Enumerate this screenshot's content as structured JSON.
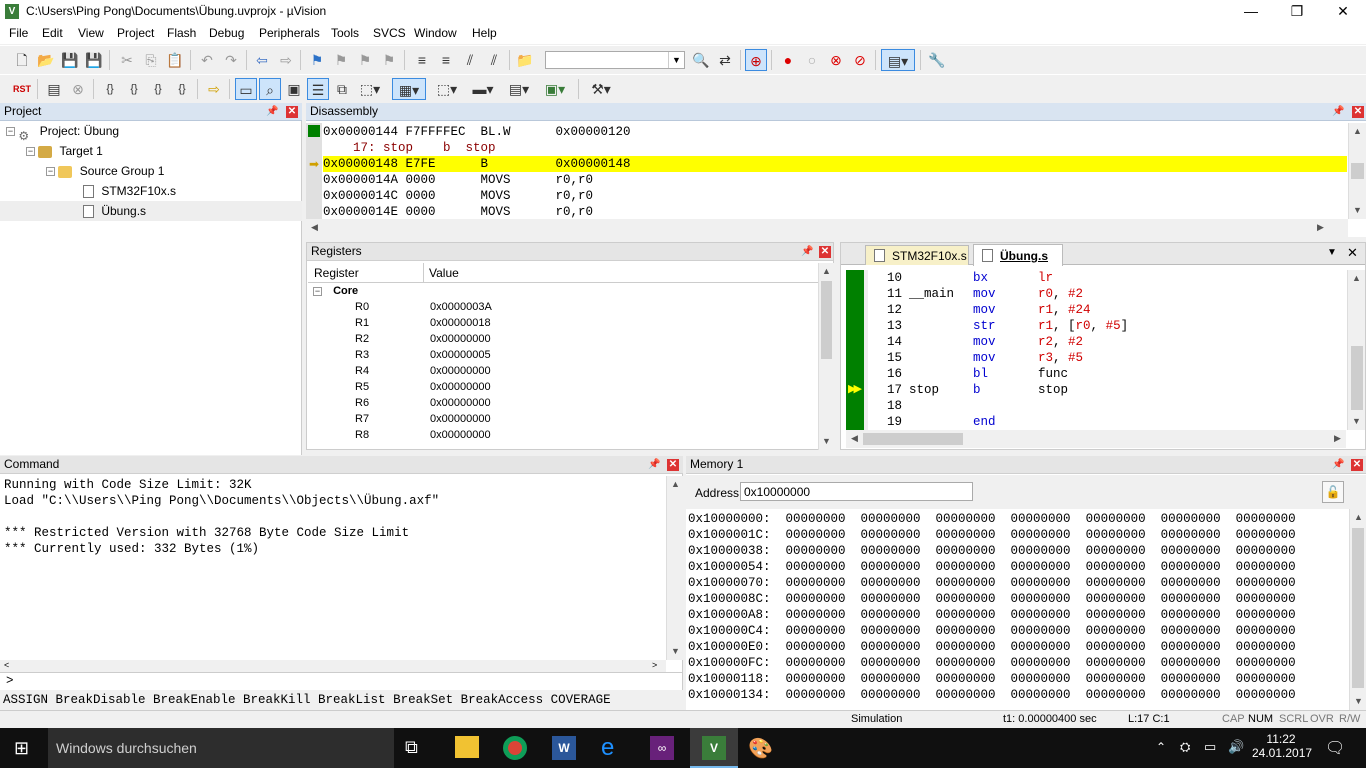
{
  "window": {
    "title": "C:\\Users\\Ping Pong\\Documents\\Übung.uvprojx - µVision",
    "min": "—",
    "max": "❐",
    "close": "✕"
  },
  "menu": [
    "File",
    "Edit",
    "View",
    "Project",
    "Flash",
    "Debug",
    "Peripherals",
    "Tools",
    "SVCS",
    "Window",
    "Help"
  ],
  "project": {
    "title": "Project",
    "root": "Project: Übung",
    "target": "Target 1",
    "group": "Source Group 1",
    "files": [
      "STM32F10x.s",
      "Übung.s"
    ]
  },
  "disassembly": {
    "title": "Disassembly",
    "lines": [
      {
        "text": "0x00000144 F7FFFFEC  BL.W      0x00000120",
        "kind": "code"
      },
      {
        "text": "    17: stop    b  stop",
        "kind": "src"
      },
      {
        "text": "0x00000148 E7FE      B         0x00000148",
        "kind": "current"
      },
      {
        "text": "0x0000014A 0000      MOVS      r0,r0",
        "kind": "code"
      },
      {
        "text": "0x0000014C 0000      MOVS      r0,r0",
        "kind": "code"
      },
      {
        "text": "0x0000014E 0000      MOVS      r0,r0",
        "kind": "code"
      }
    ]
  },
  "registers": {
    "title": "Registers",
    "col_register": "Register",
    "col_value": "Value",
    "group": "Core",
    "rows": [
      {
        "name": "R0",
        "value": "0x0000003A"
      },
      {
        "name": "R1",
        "value": "0x00000018"
      },
      {
        "name": "R2",
        "value": "0x00000000"
      },
      {
        "name": "R3",
        "value": "0x00000005"
      },
      {
        "name": "R4",
        "value": "0x00000000"
      },
      {
        "name": "R5",
        "value": "0x00000000"
      },
      {
        "name": "R6",
        "value": "0x00000000"
      },
      {
        "name": "R7",
        "value": "0x00000000"
      },
      {
        "name": "R8",
        "value": "0x00000000"
      }
    ]
  },
  "editor": {
    "tabs": [
      "STM32F10x.s",
      "Übung.s"
    ],
    "lines": [
      {
        "num": "10",
        "label": "",
        "op": "bx",
        "args": [
          {
            "t": "lr",
            "c": "#d00000"
          }
        ]
      },
      {
        "num": "11",
        "label": "__main",
        "op": "mov",
        "args": [
          {
            "t": "r0",
            "c": "#d00000"
          },
          {
            "t": ", ",
            "c": "#000"
          },
          {
            "t": "#2",
            "c": "#d00000"
          }
        ]
      },
      {
        "num": "12",
        "label": "",
        "op": "mov",
        "args": [
          {
            "t": "r1",
            "c": "#d00000"
          },
          {
            "t": ", ",
            "c": "#000"
          },
          {
            "t": "#24",
            "c": "#d00000"
          }
        ]
      },
      {
        "num": "13",
        "label": "",
        "op": "str",
        "args": [
          {
            "t": "r1",
            "c": "#d00000"
          },
          {
            "t": ", [",
            "c": "#000"
          },
          {
            "t": "r0",
            "c": "#d00000"
          },
          {
            "t": ", ",
            "c": "#000"
          },
          {
            "t": "#5",
            "c": "#d00000"
          },
          {
            "t": "]",
            "c": "#000"
          }
        ]
      },
      {
        "num": "14",
        "label": "",
        "op": "mov",
        "args": [
          {
            "t": "r2",
            "c": "#d00000"
          },
          {
            "t": ", ",
            "c": "#000"
          },
          {
            "t": "#2",
            "c": "#d00000"
          }
        ]
      },
      {
        "num": "15",
        "label": "",
        "op": "mov",
        "args": [
          {
            "t": "r3",
            "c": "#d00000"
          },
          {
            "t": ", ",
            "c": "#000"
          },
          {
            "t": "#5",
            "c": "#d00000"
          }
        ]
      },
      {
        "num": "16",
        "label": "",
        "op": "bl",
        "args": [
          {
            "t": "func",
            "c": "#000"
          }
        ]
      },
      {
        "num": "17",
        "label": "stop",
        "op": "b",
        "args": [
          {
            "t": "stop",
            "c": "#000"
          }
        ]
      },
      {
        "num": "18",
        "label": "",
        "op": "",
        "args": []
      },
      {
        "num": "19",
        "label": "",
        "op": "end",
        "args": []
      }
    ]
  },
  "command": {
    "title": "Command",
    "output": [
      "Running with Code Size Limit: 32K",
      "Load \"C:\\\\Users\\\\Ping Pong\\\\Documents\\\\Objects\\\\Übung.axf\"",
      "",
      "*** Restricted Version with 32768 Byte Code Size Limit",
      "*** Currently used: 332 Bytes (1%)"
    ],
    "prompt": ">",
    "hint": "ASSIGN BreakDisable BreakEnable BreakKill BreakList BreakSet BreakAccess COVERAGE"
  },
  "memory": {
    "title": "Memory 1",
    "address_label": "Address:",
    "address_value": "0x10000000",
    "rows": [
      "0x10000000:  00000000  00000000  00000000  00000000  00000000  00000000  00000000",
      "0x1000001C:  00000000  00000000  00000000  00000000  00000000  00000000  00000000",
      "0x10000038:  00000000  00000000  00000000  00000000  00000000  00000000  00000000",
      "0x10000054:  00000000  00000000  00000000  00000000  00000000  00000000  00000000",
      "0x10000070:  00000000  00000000  00000000  00000000  00000000  00000000  00000000",
      "0x1000008C:  00000000  00000000  00000000  00000000  00000000  00000000  00000000",
      "0x100000A8:  00000000  00000000  00000000  00000000  00000000  00000000  00000000",
      "0x100000C4:  00000000  00000000  00000000  00000000  00000000  00000000  00000000",
      "0x100000E0:  00000000  00000000  00000000  00000000  00000000  00000000  00000000",
      "0x100000FC:  00000000  00000000  00000000  00000000  00000000  00000000  00000000",
      "0x10000118:  00000000  00000000  00000000  00000000  00000000  00000000  00000000",
      "0x10000134:  00000000  00000000  00000000  00000000  00000000  00000000  00000000"
    ]
  },
  "statusbar": {
    "mode": "Simulation",
    "time": "t1: 0.00000400 sec",
    "pos": "L:17 C:1",
    "cap": "CAP",
    "num": "NUM",
    "scrl": "SCRL",
    "ovr": "OVR",
    "rw": "R/W"
  },
  "taskbar": {
    "search": "Windows durchsuchen",
    "time": "11:22",
    "date": "24.01.2017"
  },
  "colors": {
    "current_line": "#ffff00",
    "exec_bar": "#008000",
    "panel_title": "#d9e4f1",
    "src_line": "#8b0000"
  }
}
